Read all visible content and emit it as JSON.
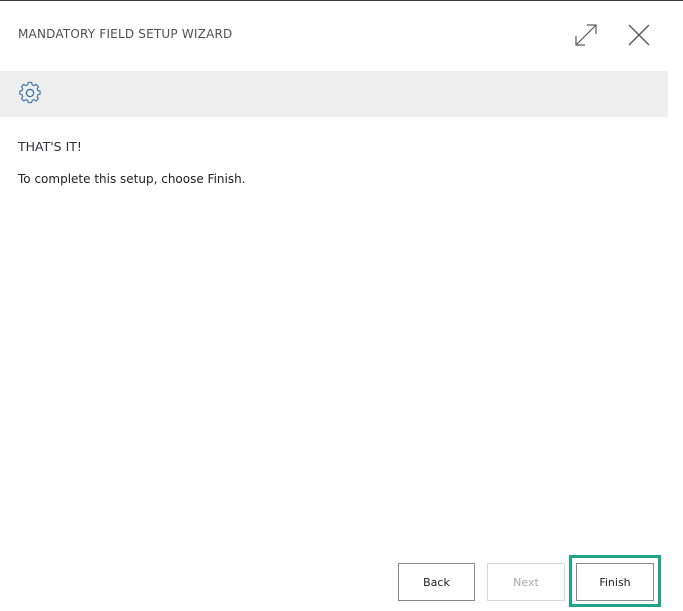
{
  "dialog": {
    "title": "MANDATORY FIELD SETUP WIZARD",
    "expand_icon": "expand-icon",
    "close_icon": "close-icon"
  },
  "toolbar": {
    "icon": "gear-icon"
  },
  "content": {
    "step_title": "THAT'S IT!",
    "step_text": "To complete this setup, choose Finish."
  },
  "footer": {
    "back_label": "Back",
    "next_label": "Next",
    "finish_label": "Finish"
  },
  "colors": {
    "highlight": "#21a38a",
    "toolbar_bg": "#eeeeee",
    "disabled_text": "#a8a8a8"
  }
}
